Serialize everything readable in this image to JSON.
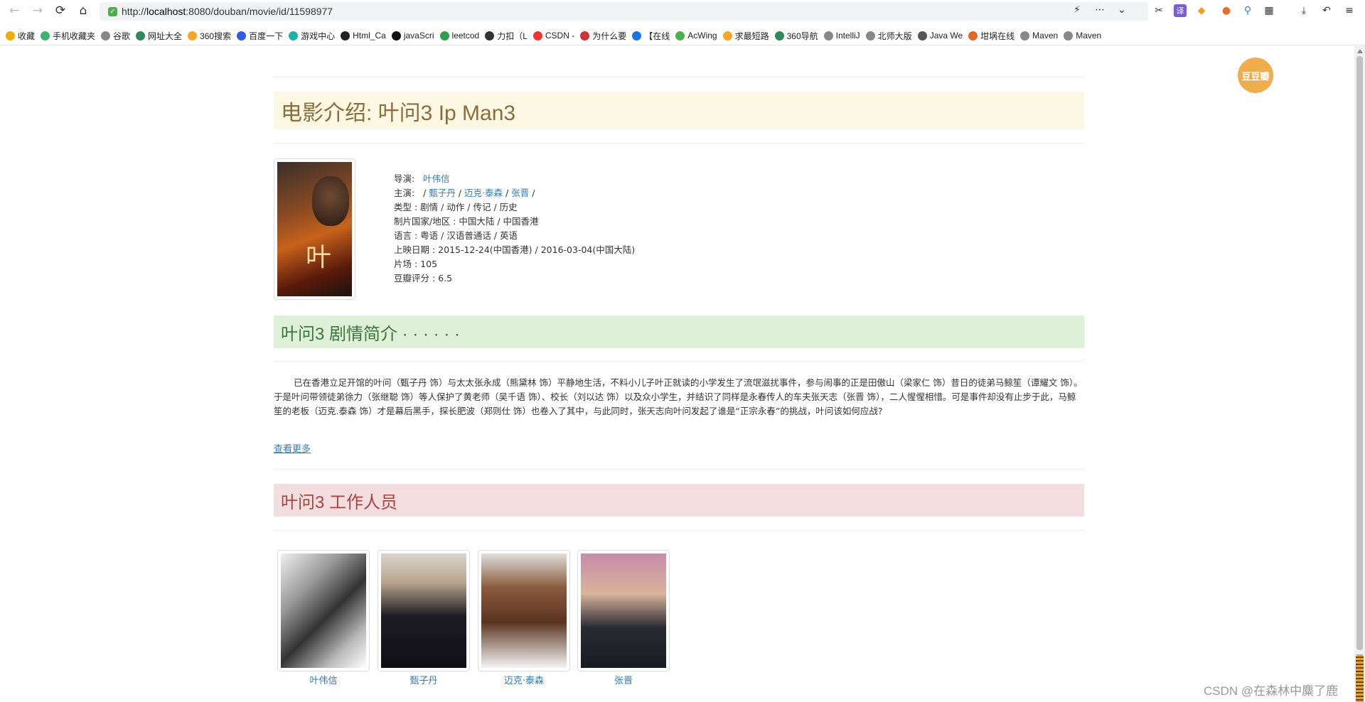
{
  "browser": {
    "url_prefix": "http://",
    "url_host": "localhost",
    "url_rest": ":8080/douban/movie/id/11598977",
    "bookmarks": [
      {
        "label": "收藏",
        "color": "#f0ad00"
      },
      {
        "label": "手机收藏夹",
        "color": "#3cb371"
      },
      {
        "label": "谷歌",
        "color": "#888"
      },
      {
        "label": "网址大全",
        "color": "#2e8b57"
      },
      {
        "label": "360搜索",
        "color": "#f5a623"
      },
      {
        "label": "百度一下",
        "color": "#2f5bea"
      },
      {
        "label": "游戏中心",
        "color": "#20b2aa"
      },
      {
        "label": "Html_Ca",
        "color": "#222"
      },
      {
        "label": "javaScri",
        "color": "#111"
      },
      {
        "label": "leetcod",
        "color": "#2aa04a"
      },
      {
        "label": "力扣（L",
        "color": "#333"
      },
      {
        "label": "CSDN -",
        "color": "#e33"
      },
      {
        "label": "为什么要",
        "color": "#c33"
      },
      {
        "label": "【在线",
        "color": "#1a73e8"
      },
      {
        "label": "AcWing",
        "color": "#4caf50"
      },
      {
        "label": "求最短路",
        "color": "#f5a623"
      },
      {
        "label": "360导航",
        "color": "#2e8b57"
      },
      {
        "label": "IntelliJ",
        "color": "#888"
      },
      {
        "label": "北师大版",
        "color": "#888"
      },
      {
        "label": "Java We",
        "color": "#555"
      },
      {
        "label": "坩埚在线",
        "color": "#e06a2a"
      },
      {
        "label": "Maven",
        "color": "#888"
      },
      {
        "label": "Maven",
        "color": "#888"
      }
    ]
  },
  "badge": "豆豆瓣",
  "movie": {
    "intro_title": "电影介绍: 叶问3 Ip Man3",
    "director_label": "导演:",
    "director": "叶伟信",
    "cast_label": "主演:",
    "cast_prefix": "/",
    "cast": [
      "甄子丹",
      "迈克·泰森",
      "张晋"
    ],
    "sep": "/",
    "genre": "类型 : 剧情 / 动作 / 传记 / 历史",
    "region": "制片国家/地区 : 中国大陆 / 中国香港",
    "language": "语言 : 粤语 / 汉语普通话 / 英语",
    "release": "上映日期 : 2015-12-24(中国香港) / 2016-03-04(中国大陆)",
    "runtime": "片场 : 105",
    "rating": "豆瓣评分 : 6.5"
  },
  "plot": {
    "title": "叶问3 剧情简介 · · · · · ·",
    "text": "已在香港立足开馆的叶问（甄子丹 饰）与太太张永成（熊黛林 饰）平静地生活，不料小儿子叶正就读的小学发生了流氓滋扰事件，参与闹事的正是田傲山（梁家仁 饰）昔日的徒弟马鲸笙（谭耀文 饰）。于是叶问带领徒弟徐力（张继聪 饰）等人保护了黄老师（吴千语 饰）、校长（刘以达 饰）以及众小学生，并结识了同样是永春传人的车夫张天志（张晋 饰），二人惺惺相惜。可是事件却没有止步于此，马鲸笙的老板（迈克.泰森 饰）才是幕后黑手，探长肥波（郑则仕 饰）也卷入了其中，与此同时，张天志向叶问发起了谁是“正宗永春”的挑战，叶问该如何应战?",
    "more": "查看更多"
  },
  "staff": {
    "title": "叶问3 工作人员",
    "people": [
      {
        "name": "叶伟信"
      },
      {
        "name": "甄子丹"
      },
      {
        "name": "迈克·泰森"
      },
      {
        "name": "张晋"
      }
    ]
  },
  "watermark": "CSDN @在森林中麋了鹿"
}
